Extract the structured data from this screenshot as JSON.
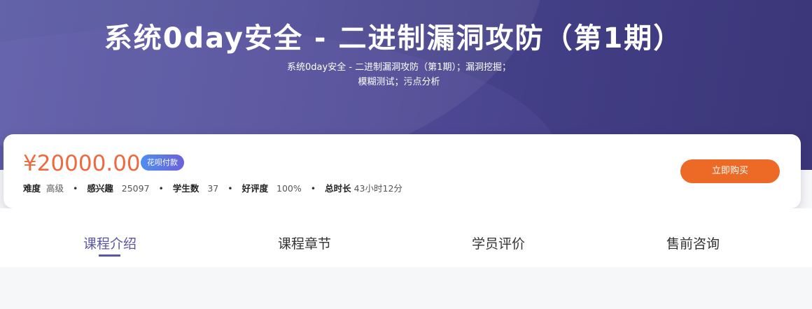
{
  "hero": {
    "title": "系统0day安全 - 二进制漏洞攻防（第1期）",
    "subtitle_line1": "系统0day安全 - 二进制漏洞攻防（第1期）；漏洞挖掘；",
    "subtitle_line2": "模糊测试；污点分析"
  },
  "info": {
    "price": "¥20000.00",
    "badge": "花呗付款",
    "stats": [
      {
        "label": "难度",
        "value": "高级"
      },
      {
        "label": "感兴趣",
        "value": "25097"
      },
      {
        "label": "学生数",
        "value": "37"
      },
      {
        "label": "好评度",
        "value": "100%"
      },
      {
        "label": "总时长",
        "value": "43小时12分"
      }
    ],
    "buy_label": "立即购买"
  },
  "tabs": [
    {
      "label": "课程介绍",
      "active": true
    },
    {
      "label": "课程章节",
      "active": false
    },
    {
      "label": "学员评价",
      "active": false
    },
    {
      "label": "售前咨询",
      "active": false
    }
  ],
  "colors": {
    "accent": "#5b56a2",
    "price": "#ee6a3e",
    "buy_button": "#ec6a25"
  }
}
